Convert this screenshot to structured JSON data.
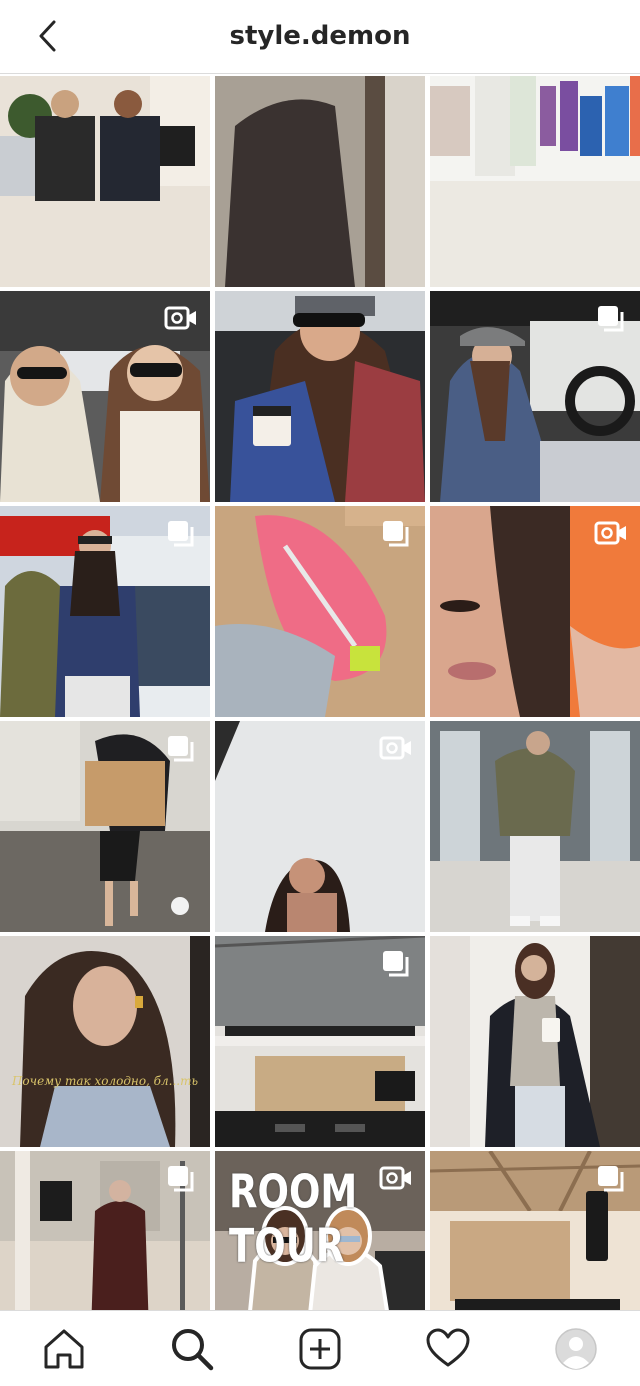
{
  "header": {
    "title": "style.demon",
    "back_icon": "chevron-left-icon"
  },
  "grid": {
    "tiles": [
      {
        "kind": "post",
        "badge": "none"
      },
      {
        "kind": "post",
        "badge": "none"
      },
      {
        "kind": "post",
        "badge": "none"
      },
      {
        "kind": "video",
        "badge": "igtv-icon"
      },
      {
        "kind": "post",
        "badge": "none"
      },
      {
        "kind": "carousel",
        "badge": "carousel-icon"
      },
      {
        "kind": "carousel",
        "badge": "carousel-icon"
      },
      {
        "kind": "carousel",
        "badge": "carousel-icon"
      },
      {
        "kind": "video",
        "badge": "igtv-icon"
      },
      {
        "kind": "carousel",
        "badge": "carousel-icon"
      },
      {
        "kind": "video",
        "badge": "igtv-icon"
      },
      {
        "kind": "post",
        "badge": "none"
      },
      {
        "kind": "post",
        "badge": "none",
        "caption": "Почему так холодно, бл...ть"
      },
      {
        "kind": "carousel",
        "badge": "carousel-icon"
      },
      {
        "kind": "post",
        "badge": "none"
      },
      {
        "kind": "carousel",
        "badge": "carousel-icon"
      },
      {
        "kind": "video",
        "badge": "igtv-icon",
        "overlay_text": "ROOM TOUR"
      },
      {
        "kind": "carousel",
        "badge": "carousel-icon"
      }
    ]
  },
  "tabbar": {
    "items": [
      "home-icon",
      "search-icon",
      "new-post-icon",
      "activity-heart-icon",
      "profile-avatar"
    ]
  },
  "colors": {
    "border": "#dbdbdb",
    "text": "#262626"
  }
}
